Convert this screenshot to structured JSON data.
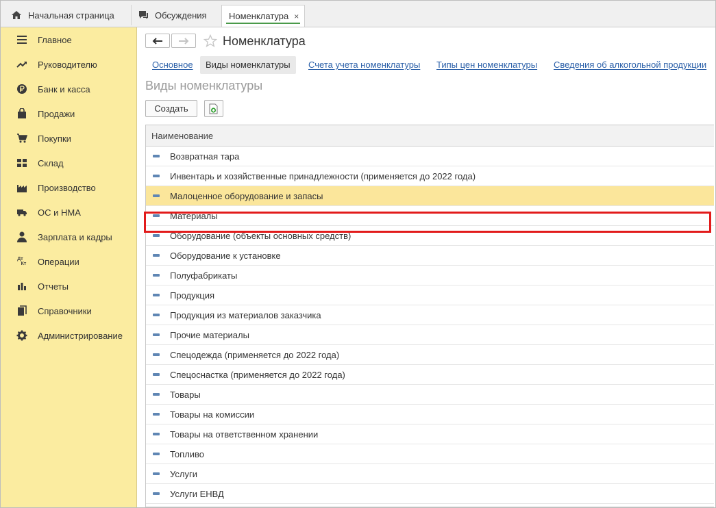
{
  "tabs": {
    "home": "Начальная страница",
    "discussions": "Обсуждения",
    "active": "Номенклатура",
    "close": "×"
  },
  "sidebar": {
    "items": [
      {
        "label": "Главное",
        "icon": "menu-icon"
      },
      {
        "label": "Руководителю",
        "icon": "trend-icon"
      },
      {
        "label": "Банк и касса",
        "icon": "ruble-icon"
      },
      {
        "label": "Продажи",
        "icon": "bag-icon"
      },
      {
        "label": "Покупки",
        "icon": "cart-icon"
      },
      {
        "label": "Склад",
        "icon": "warehouse-icon"
      },
      {
        "label": "Производство",
        "icon": "factory-icon"
      },
      {
        "label": "ОС и НМА",
        "icon": "truck-icon"
      },
      {
        "label": "Зарплата и кадры",
        "icon": "person-icon"
      },
      {
        "label": "Операции",
        "icon": "dt-kt-icon"
      },
      {
        "label": "Отчеты",
        "icon": "bar-chart-icon"
      },
      {
        "label": "Справочники",
        "icon": "book-icon"
      },
      {
        "label": "Администрирование",
        "icon": "gear-icon"
      }
    ],
    "dt_glyph": "Дт",
    "kt_glyph": "Кт"
  },
  "header": {
    "title": "Номенклатура"
  },
  "subtabs": [
    "Основное",
    "Виды номенклатуры",
    "Счета учета номенклатуры",
    "Типы цен номенклатуры",
    "Сведения об алкогольной продукции"
  ],
  "section_title": "Виды номенклатуры",
  "toolbar": {
    "create_label": "Создать"
  },
  "table": {
    "column": "Наименование",
    "rows": [
      "Возвратная тара",
      "Инвентарь и хозяйственные принадлежности (применяется до 2022 года)",
      "Малоценное оборудование и запасы",
      "Материалы",
      "Оборудование (объекты основных средств)",
      "Оборудование к установке",
      "Полуфабрикаты",
      "Продукция",
      "Продукция из материалов заказчика",
      "Прочие материалы",
      "Спецодежда (применяется до 2022 года)",
      "Спецоснастка (применяется до 2022 года)",
      "Товары",
      "Товары на комиссии",
      "Товары на ответственном хранении",
      "Топливо",
      "Услуги",
      "Услуги ЕНВД"
    ],
    "selected_index": 2
  },
  "colors": {
    "sidebar_bg": "#fbeca0",
    "selected_row": "#fbe69b",
    "highlight_border": "#e21b1b",
    "link": "#2a5fa8"
  }
}
